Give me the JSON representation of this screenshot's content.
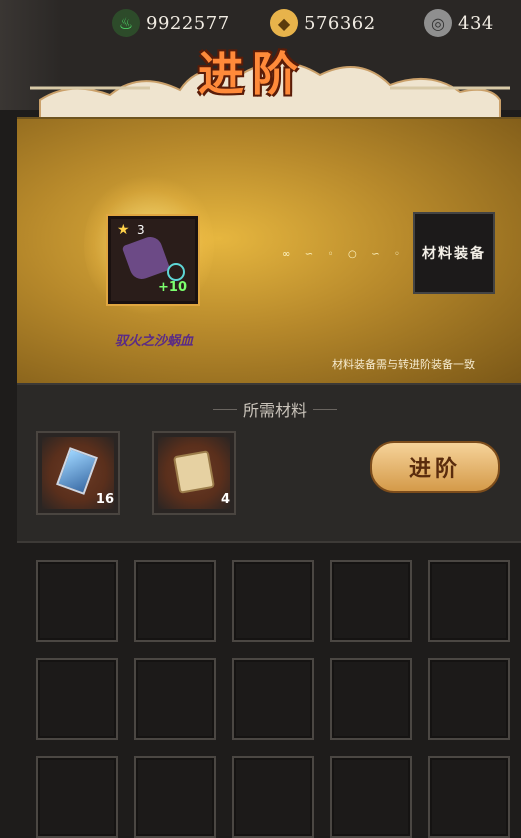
{
  "resources": {
    "energy": {
      "icon": "green-energy-icon",
      "value": "9922577"
    },
    "coins": {
      "icon": "gold-coin-icon",
      "value": "576362"
    },
    "silver": {
      "icon": "silver-coin-icon",
      "value": "434"
    }
  },
  "title": "进阶",
  "equipment": {
    "stars": "3",
    "enhance": "+10",
    "name": "驭火之沙蜗血"
  },
  "material_slot": {
    "label": "材料装备"
  },
  "material_note": "材料装备需与转进阶装备一致",
  "required_materials": {
    "header": "所需材料",
    "items": [
      {
        "icon": "crystal-icon",
        "count": "16"
      },
      {
        "icon": "scroll-icon",
        "count": "4"
      }
    ]
  },
  "advance_button": "进阶",
  "colors": {
    "accent_gold": "#e6b63f",
    "title_orange": "#ff8a3a",
    "enhance_green": "#7cff6e"
  }
}
